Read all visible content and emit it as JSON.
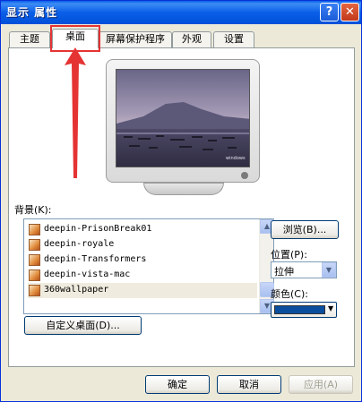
{
  "window": {
    "title": "显示 属性",
    "help_label": "?",
    "close_label": "✕"
  },
  "tabs": [
    {
      "label": "主题"
    },
    {
      "label": "桌面"
    },
    {
      "label": "屏幕保护程序"
    },
    {
      "label": "外观"
    },
    {
      "label": "设置"
    }
  ],
  "monitor": {
    "preview_caption": "windows"
  },
  "background": {
    "label": "背景(K):",
    "items": [
      {
        "label": "deepin-PrisonBreak01"
      },
      {
        "label": "deepin-royale"
      },
      {
        "label": "deepin-Transformers"
      },
      {
        "label": "deepin-vista-mac"
      },
      {
        "label": "360wallpaper"
      }
    ],
    "selected_index": 4
  },
  "controls": {
    "browse_label": "浏览(B)...",
    "position_label": "位置(P):",
    "position_value": "拉伸",
    "color_label": "颜色(C):",
    "color_value": "#0A4E9E",
    "customize_label": "自定义桌面(D)..."
  },
  "footer": {
    "ok_label": "确定",
    "cancel_label": "取消",
    "apply_label": "应用(A)"
  },
  "colors": {
    "titlebar": "#0A5FE8",
    "highlight": "#E53333",
    "dialog_bg": "#ECE9D8"
  }
}
